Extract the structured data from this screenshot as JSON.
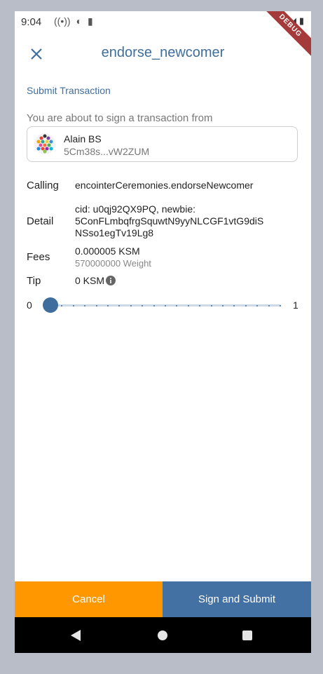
{
  "status": {
    "time": "9:04",
    "debug": "DEBUG"
  },
  "appbar": {
    "title": "endorse_newcomer"
  },
  "section_title": "Submit Transaction",
  "from_label": "You are about to sign a transaction from",
  "account": {
    "name": "Alain BS",
    "address": "5Cm38s...vW2ZUM"
  },
  "rows": {
    "calling_label": "Calling",
    "calling_value": "encointerCeremonies.endorseNewcomer",
    "detail_label": "Detail",
    "detail_value_1": "cid: u0qj92QX9PQ, newbie:",
    "detail_value_2": "5ConFLmbqfrgSquwtN9yyNLCGF1vtG9diS",
    "detail_value_3": "NSso1egTv19Lg8",
    "fees_label": "Fees",
    "fees_value": "0.000005 KSM",
    "fees_weight": "570000000 Weight",
    "tip_label": "Tip",
    "tip_value": "0 KSM"
  },
  "slider": {
    "min_label": "0",
    "max_label": "1",
    "value": 0
  },
  "buttons": {
    "cancel": "Cancel",
    "submit": "Sign and Submit"
  },
  "colors": {
    "accent": "#3f6e9d",
    "cancel": "#ff9800",
    "submit": "#4471a3"
  },
  "icons": [
    "close-icon",
    "info-icon",
    "wifi-icon",
    "signal-icon",
    "battery-icon",
    "nav-back-icon",
    "nav-home-icon",
    "nav-recent-icon"
  ]
}
